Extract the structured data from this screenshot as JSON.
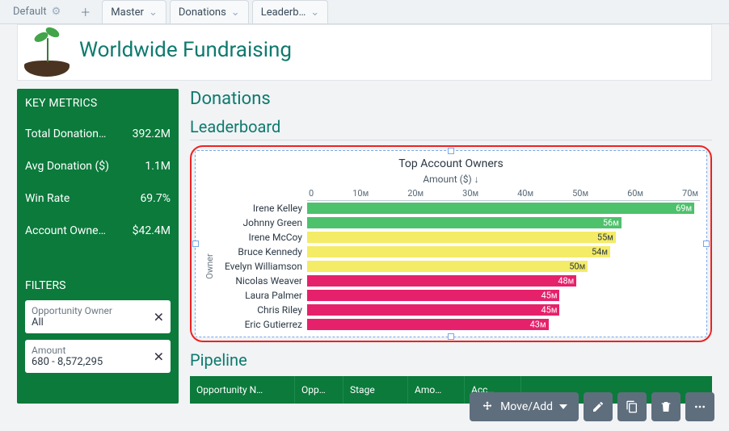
{
  "tabstrip": {
    "default_label": "Default",
    "add_icon": "plus",
    "tabs": [
      {
        "label": "Master"
      },
      {
        "label": "Donations"
      },
      {
        "label": "Leaderb…"
      }
    ]
  },
  "header": {
    "title": "Worldwide Fundraising"
  },
  "sidebar": {
    "metrics_title": "KEY METRICS",
    "metrics": [
      {
        "label": "Total Donation…",
        "value": "392.2M"
      },
      {
        "label": "Avg Donation ($)",
        "value": "1.1M"
      },
      {
        "label": "Win Rate",
        "value": "69.7%"
      },
      {
        "label": "Account Owne…",
        "value": "$42.4M"
      }
    ],
    "filters_title": "FILTERS",
    "filters": [
      {
        "name": "Opportunity Owner",
        "value": "All"
      },
      {
        "name": "Amount",
        "value": "680 - 8,572,295"
      }
    ]
  },
  "main": {
    "donations_heading": "Donations",
    "leaderboard_heading": "Leaderboard",
    "pipeline_heading": "Pipeline",
    "pipeline_cols": [
      "Opportunity N…",
      "Opp…",
      "Stage",
      "Amo…",
      "Acc…"
    ]
  },
  "chart_data": {
    "type": "bar",
    "orientation": "horizontal",
    "title": "Top Account Owners",
    "xlabel": "Amount ($) ↓",
    "ylabel": "Owner",
    "xlim": [
      0,
      70
    ],
    "unit_suffix": "M",
    "ticks": [
      0,
      10,
      20,
      30,
      40,
      50,
      60,
      70
    ],
    "categories": [
      "Irene Kelley",
      "Johnny Green",
      "Irene McCoy",
      "Bruce Kennedy",
      "Evelyn Williamson",
      "Nicolas Weaver",
      "Laura Palmer",
      "Chris Riley",
      "Eric Gutierrez"
    ],
    "values": [
      69,
      56,
      55,
      54,
      50,
      48,
      45,
      45,
      43
    ],
    "colors": [
      "green",
      "green",
      "yellow",
      "yellow",
      "yellow",
      "pink",
      "pink",
      "pink",
      "pink"
    ]
  },
  "float_toolbar": {
    "move_label": "Move/Add"
  }
}
